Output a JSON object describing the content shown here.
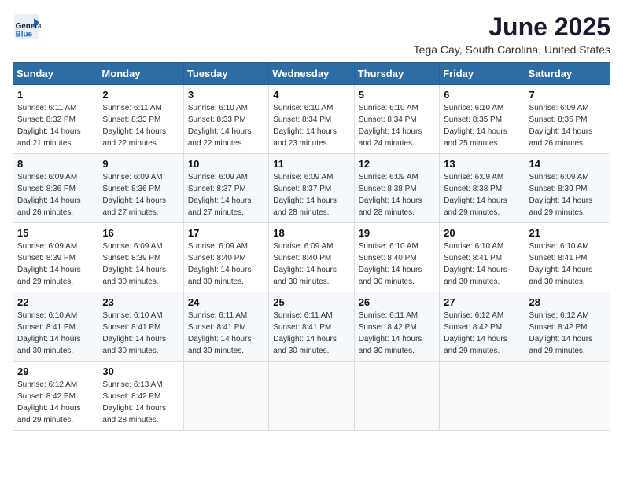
{
  "logo": {
    "line1": "General",
    "line2": "Blue"
  },
  "title": "June 2025",
  "subtitle": "Tega Cay, South Carolina, United States",
  "weekdays": [
    "Sunday",
    "Monday",
    "Tuesday",
    "Wednesday",
    "Thursday",
    "Friday",
    "Saturday"
  ],
  "weeks": [
    [
      {
        "day": "1",
        "sunrise": "6:11 AM",
        "sunset": "8:32 PM",
        "daylight": "14 hours and 21 minutes."
      },
      {
        "day": "2",
        "sunrise": "6:11 AM",
        "sunset": "8:33 PM",
        "daylight": "14 hours and 22 minutes."
      },
      {
        "day": "3",
        "sunrise": "6:10 AM",
        "sunset": "8:33 PM",
        "daylight": "14 hours and 22 minutes."
      },
      {
        "day": "4",
        "sunrise": "6:10 AM",
        "sunset": "8:34 PM",
        "daylight": "14 hours and 23 minutes."
      },
      {
        "day": "5",
        "sunrise": "6:10 AM",
        "sunset": "8:34 PM",
        "daylight": "14 hours and 24 minutes."
      },
      {
        "day": "6",
        "sunrise": "6:10 AM",
        "sunset": "8:35 PM",
        "daylight": "14 hours and 25 minutes."
      },
      {
        "day": "7",
        "sunrise": "6:09 AM",
        "sunset": "8:35 PM",
        "daylight": "14 hours and 26 minutes."
      }
    ],
    [
      {
        "day": "8",
        "sunrise": "6:09 AM",
        "sunset": "8:36 PM",
        "daylight": "14 hours and 26 minutes."
      },
      {
        "day": "9",
        "sunrise": "6:09 AM",
        "sunset": "8:36 PM",
        "daylight": "14 hours and 27 minutes."
      },
      {
        "day": "10",
        "sunrise": "6:09 AM",
        "sunset": "8:37 PM",
        "daylight": "14 hours and 27 minutes."
      },
      {
        "day": "11",
        "sunrise": "6:09 AM",
        "sunset": "8:37 PM",
        "daylight": "14 hours and 28 minutes."
      },
      {
        "day": "12",
        "sunrise": "6:09 AM",
        "sunset": "8:38 PM",
        "daylight": "14 hours and 28 minutes."
      },
      {
        "day": "13",
        "sunrise": "6:09 AM",
        "sunset": "8:38 PM",
        "daylight": "14 hours and 29 minutes."
      },
      {
        "day": "14",
        "sunrise": "6:09 AM",
        "sunset": "8:39 PM",
        "daylight": "14 hours and 29 minutes."
      }
    ],
    [
      {
        "day": "15",
        "sunrise": "6:09 AM",
        "sunset": "8:39 PM",
        "daylight": "14 hours and 29 minutes."
      },
      {
        "day": "16",
        "sunrise": "6:09 AM",
        "sunset": "8:39 PM",
        "daylight": "14 hours and 30 minutes."
      },
      {
        "day": "17",
        "sunrise": "6:09 AM",
        "sunset": "8:40 PM",
        "daylight": "14 hours and 30 minutes."
      },
      {
        "day": "18",
        "sunrise": "6:09 AM",
        "sunset": "8:40 PM",
        "daylight": "14 hours and 30 minutes."
      },
      {
        "day": "19",
        "sunrise": "6:10 AM",
        "sunset": "8:40 PM",
        "daylight": "14 hours and 30 minutes."
      },
      {
        "day": "20",
        "sunrise": "6:10 AM",
        "sunset": "8:41 PM",
        "daylight": "14 hours and 30 minutes."
      },
      {
        "day": "21",
        "sunrise": "6:10 AM",
        "sunset": "8:41 PM",
        "daylight": "14 hours and 30 minutes."
      }
    ],
    [
      {
        "day": "22",
        "sunrise": "6:10 AM",
        "sunset": "8:41 PM",
        "daylight": "14 hours and 30 minutes."
      },
      {
        "day": "23",
        "sunrise": "6:10 AM",
        "sunset": "8:41 PM",
        "daylight": "14 hours and 30 minutes."
      },
      {
        "day": "24",
        "sunrise": "6:11 AM",
        "sunset": "8:41 PM",
        "daylight": "14 hours and 30 minutes."
      },
      {
        "day": "25",
        "sunrise": "6:11 AM",
        "sunset": "8:41 PM",
        "daylight": "14 hours and 30 minutes."
      },
      {
        "day": "26",
        "sunrise": "6:11 AM",
        "sunset": "8:42 PM",
        "daylight": "14 hours and 30 minutes."
      },
      {
        "day": "27",
        "sunrise": "6:12 AM",
        "sunset": "8:42 PM",
        "daylight": "14 hours and 29 minutes."
      },
      {
        "day": "28",
        "sunrise": "6:12 AM",
        "sunset": "8:42 PM",
        "daylight": "14 hours and 29 minutes."
      }
    ],
    [
      {
        "day": "29",
        "sunrise": "6:12 AM",
        "sunset": "8:42 PM",
        "daylight": "14 hours and 29 minutes."
      },
      {
        "day": "30",
        "sunrise": "6:13 AM",
        "sunset": "8:42 PM",
        "daylight": "14 hours and 28 minutes."
      },
      null,
      null,
      null,
      null,
      null
    ]
  ]
}
